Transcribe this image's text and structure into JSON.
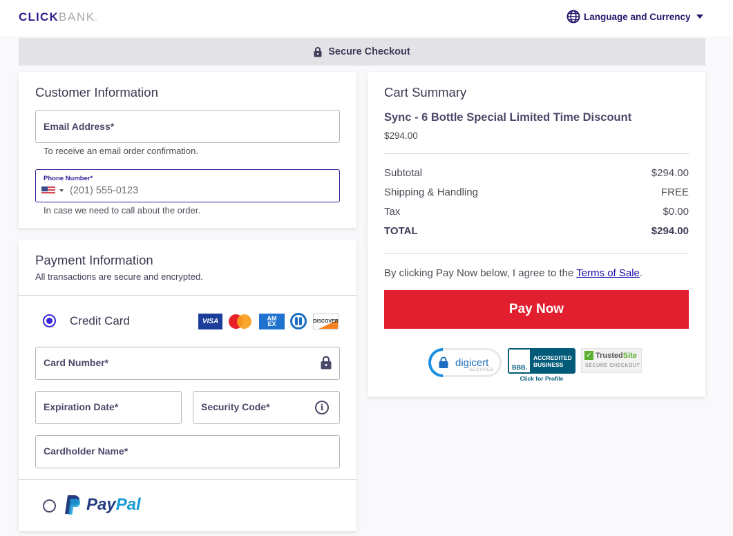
{
  "header": {
    "logo_primary": "CLICK",
    "logo_secondary": "BANK",
    "logo_suffix": ".",
    "language_label": "Language and Currency"
  },
  "secure_bar": {
    "label": "Secure Checkout"
  },
  "customer": {
    "title": "Customer Information",
    "email": {
      "label": "Email Address*",
      "value": "",
      "hint": "To receive an email order confirmation."
    },
    "phone": {
      "label": "Phone Number*",
      "country": "US",
      "placeholder": "(201) 555-0123",
      "hint": "In case we need to call about the order."
    }
  },
  "payment": {
    "title": "Payment Information",
    "subtitle": "All transactions are secure and encrypted.",
    "methods": [
      {
        "label": "Credit Card",
        "selected": true
      },
      {
        "label": "PayPal",
        "selected": false
      }
    ],
    "card_brands": [
      "VISA",
      "Mastercard",
      "AMEX",
      "Diners Club",
      "DISCOVER"
    ],
    "fields": {
      "card_number": "Card Number*",
      "expiration": "Expiration Date*",
      "security_code": "Security Code*",
      "cardholder": "Cardholder Name*"
    },
    "paypal_word_1": "Pay",
    "paypal_word_2": "Pal"
  },
  "cart": {
    "title": "Cart Summary",
    "product_name": "Sync - 6 Bottle Special Limited Time Discount",
    "product_price": "$294.00",
    "lines": [
      {
        "label": "Subtotal",
        "value": "$294.00"
      },
      {
        "label": "Shipping & Handling",
        "value": "FREE"
      },
      {
        "label": "Tax",
        "value": "$0.00"
      }
    ],
    "total": {
      "label": "TOTAL",
      "value": "$294.00"
    },
    "agree_prefix": "By clicking Pay Now below, I agree to the ",
    "terms_link": "Terms of Sale",
    "agree_suffix": ".",
    "pay_button": "Pay Now",
    "badges": {
      "digicert": "digicert",
      "digicert_sub": "SECURED",
      "bbb_logo": "BBB.",
      "bbb_line1": "ACCREDITED",
      "bbb_line2": "BUSINESS",
      "bbb_link": "Click for Profile",
      "trusted_1": "Trusted",
      "trusted_2": "Site",
      "trusted_sub": "SECURE CHECKOUT"
    }
  },
  "colors": {
    "brand": "#2b1f8f",
    "pay_button": "#e21f2f",
    "radio_selected": "#3725d8"
  }
}
